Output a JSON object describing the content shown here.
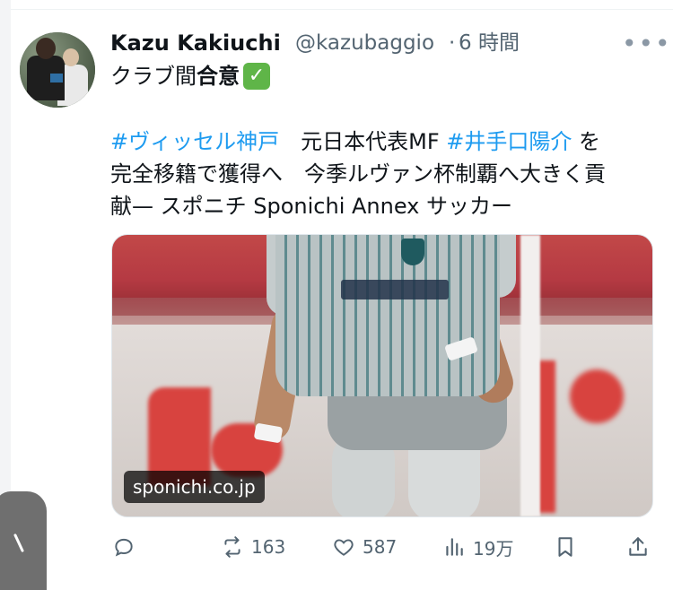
{
  "tweet": {
    "author_name": "Kazu Kakiuchi",
    "handle": "@kazubaggio",
    "separator": "·",
    "time": "6 時間",
    "more_icon": "more-horizontal-icon",
    "line1_plain": "クラブ間",
    "line1_bold": "合意",
    "line1_emoji": "✓",
    "text": {
      "hashtag1": "#ヴィッセル神戸",
      "part1": "元日本代表MF",
      "hashtag2": "#井手口陽介",
      "part2": "を",
      "row2": "完全移籍で獲得へ　今季ルヴァン杯制覇へ大きく貢",
      "row3": "献— スポニチ Sponichi Annex サッカー"
    },
    "media": {
      "source": "sponichi.co.jp"
    },
    "actions": {
      "reply_icon": "reply-icon",
      "retweet_icon": "retweet-icon",
      "retweet_count": "163",
      "like_icon": "heart-icon",
      "like_count": "587",
      "views_icon": "views-icon",
      "views_count": "19万",
      "bookmark_icon": "bookmark-icon",
      "share_icon": "share-icon"
    }
  },
  "colors": {
    "hashtag": "#1d9bf0",
    "secondary_text": "#536471",
    "check_emoji_bg": "#5fb548"
  }
}
